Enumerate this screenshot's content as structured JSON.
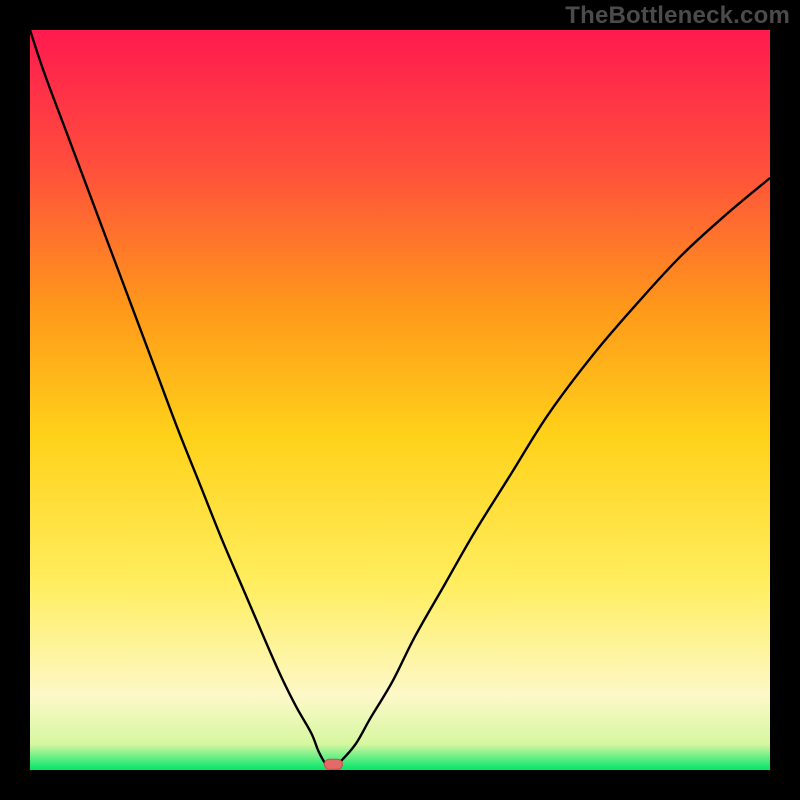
{
  "watermark": "TheBottleneck.com",
  "colors": {
    "frame": "#000000",
    "curve": "#000000",
    "marker_fill": "#e46a6a",
    "marker_stroke": "#c84d4d",
    "gradient_top": "#ff1a4f",
    "gradient_mid_upper": "#ff7a2a",
    "gradient_mid": "#ffd21a",
    "gradient_mid_lower": "#ffee60",
    "gradient_pale": "#fdf8c8",
    "gradient_bottom": "#00e66b"
  },
  "chart_data": {
    "type": "line",
    "title": "",
    "xlabel": "",
    "ylabel": "",
    "xlim": [
      0,
      100
    ],
    "ylim": [
      0,
      100
    ],
    "x_min_at": 40,
    "marker": {
      "x": 41,
      "y": 0.5
    },
    "series": [
      {
        "name": "bottleneck-curve",
        "x": [
          0,
          2,
          5,
          8,
          11,
          14,
          17,
          20,
          23,
          26,
          29,
          32,
          34,
          36,
          38,
          39,
          40,
          41,
          42,
          44,
          46,
          49,
          52,
          56,
          60,
          65,
          70,
          76,
          82,
          88,
          94,
          100
        ],
        "y": [
          100,
          94,
          86,
          78,
          70,
          62,
          54,
          46,
          38.5,
          31,
          24,
          17,
          12.5,
          8.5,
          5,
          2.5,
          0.8,
          0.5,
          1.2,
          3.5,
          7,
          12,
          18,
          25,
          32,
          40,
          48,
          56,
          63,
          69.5,
          75,
          80
        ]
      }
    ],
    "gradient_stops": [
      {
        "offset": 0.0,
        "color": "#ff1a4f"
      },
      {
        "offset": 0.18,
        "color": "#ff4d3d"
      },
      {
        "offset": 0.38,
        "color": "#ff9a1a"
      },
      {
        "offset": 0.55,
        "color": "#ffd21a"
      },
      {
        "offset": 0.75,
        "color": "#ffee60"
      },
      {
        "offset": 0.9,
        "color": "#fdf8c8"
      },
      {
        "offset": 0.965,
        "color": "#d6f7a0"
      },
      {
        "offset": 1.0,
        "color": "#00e66b"
      }
    ]
  }
}
